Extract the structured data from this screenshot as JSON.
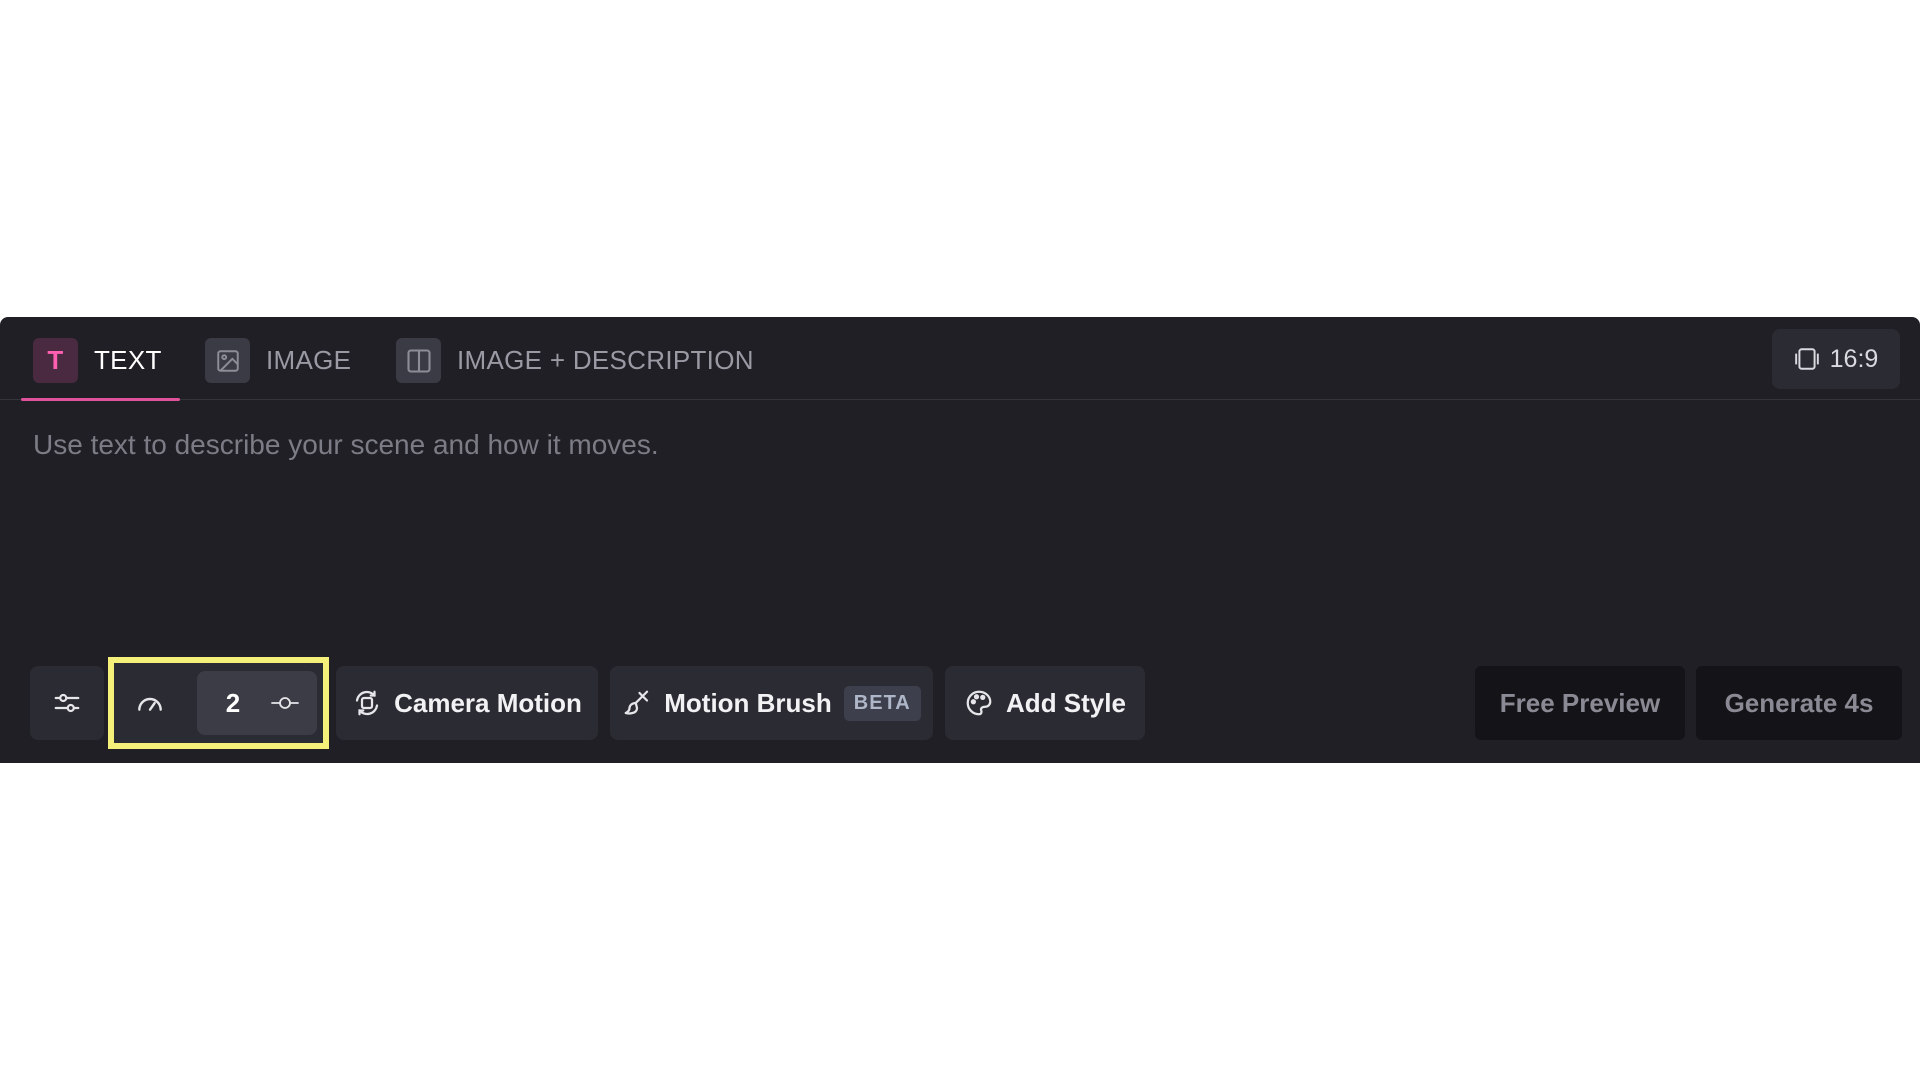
{
  "tabs": [
    {
      "label": "TEXT",
      "icon": "text-t-icon",
      "active": true
    },
    {
      "label": "IMAGE",
      "icon": "image-icon",
      "active": false
    },
    {
      "label": "IMAGE + DESCRIPTION",
      "icon": "split-view-icon",
      "active": false
    }
  ],
  "aspect_ratio": {
    "label": "16:9",
    "icon": "aspect-frame-icon"
  },
  "prompt": {
    "placeholder": "Use text to describe your scene and how it moves.",
    "value": ""
  },
  "toolbar": {
    "settings_icon": "sliders-icon",
    "duration": {
      "icon": "speedometer-icon",
      "value": "2",
      "slider_icon": "slider-knob-icon"
    },
    "camera_motion": {
      "label": "Camera Motion",
      "icon": "camera-orbit-icon"
    },
    "motion_brush": {
      "label": "Motion Brush",
      "badge": "BETA",
      "icon": "brush-icon"
    },
    "add_style": {
      "label": "Add Style",
      "icon": "palette-icon"
    },
    "free_preview": {
      "label": "Free Preview"
    },
    "generate": {
      "label": "Generate 4s"
    }
  },
  "colors": {
    "accent": "#e0529a",
    "highlight": "#f5f07a",
    "panel": "#1f1f25"
  }
}
